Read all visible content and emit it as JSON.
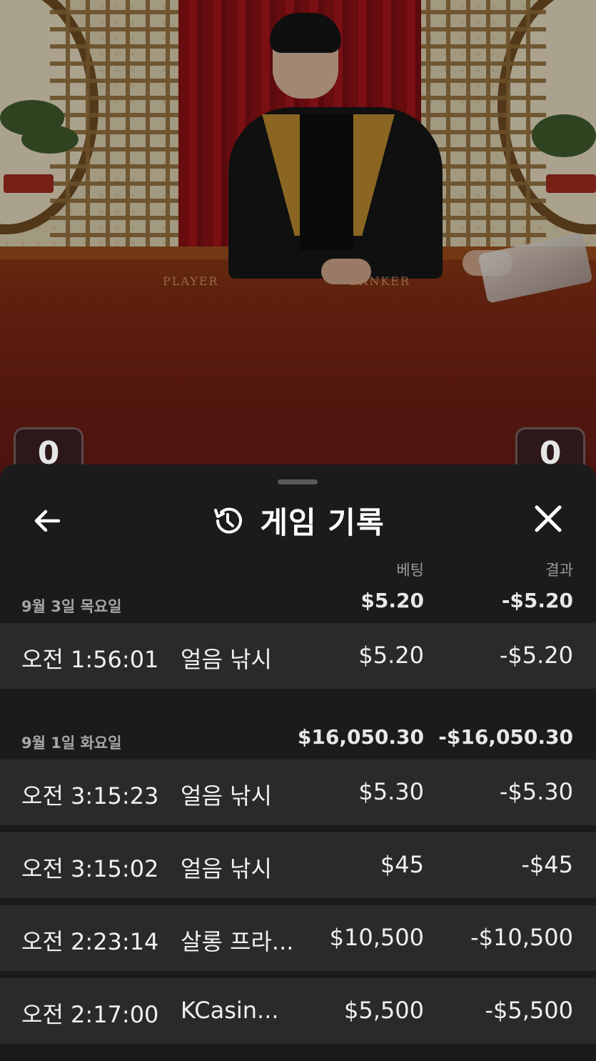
{
  "table_felt": {
    "player_label": "PLAYER",
    "banker_label": "BANKER"
  },
  "scores": {
    "player": "0",
    "banker": "0"
  },
  "sheet": {
    "title": "게임 기록",
    "columns": {
      "bet": "베팅",
      "result": "결과"
    },
    "groups": [
      {
        "date": "9월 3일 목요일",
        "bet_total": "$5.20",
        "result_total": "-$5.20",
        "rows": [
          {
            "time": "오전 1:56:01",
            "game": "얼음 낚시",
            "bet": "$5.20",
            "result": "-$5.20"
          }
        ]
      },
      {
        "date": "9월 1일 화요일",
        "bet_total": "$16,050.30",
        "result_total": "-$16,050.30",
        "rows": [
          {
            "time": "오전 3:15:23",
            "game": "얼음 낚시",
            "bet": "$5.30",
            "result": "-$5.30"
          },
          {
            "time": "오전 3:15:02",
            "game": "얼음 낚시",
            "bet": "$45",
            "result": "-$45"
          },
          {
            "time": "오전 2:23:14",
            "game": "살롱 프라...",
            "bet": "$10,500",
            "result": "-$10,500"
          },
          {
            "time": "오전 2:17:00",
            "game": "KCasin...",
            "bet": "$5,500",
            "result": "-$5,500"
          }
        ]
      }
    ]
  },
  "icons": {
    "back": "arrow-left-icon",
    "history": "history-icon",
    "close": "close-icon"
  },
  "colors": {
    "sheet_bg": "#1b1b1b",
    "row_bg": "#2a2a2a",
    "text": "#f0f0f0",
    "muted": "#9a9a9a"
  }
}
